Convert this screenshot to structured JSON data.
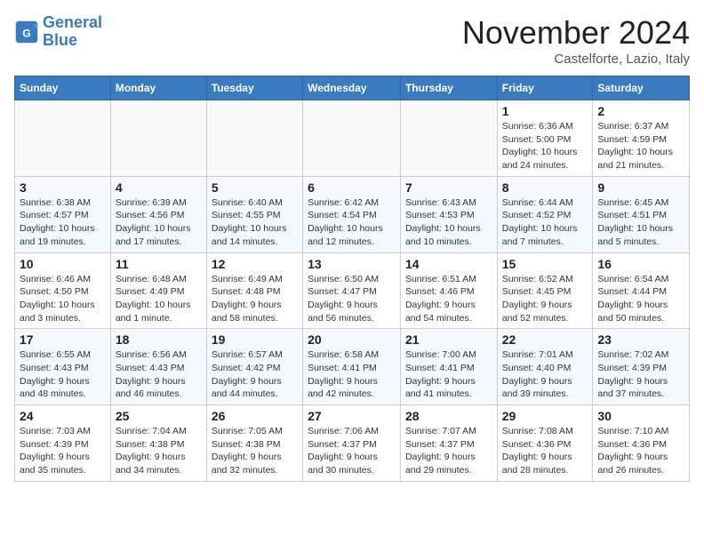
{
  "header": {
    "logo_line1": "General",
    "logo_line2": "Blue",
    "month": "November 2024",
    "location": "Castelforte, Lazio, Italy"
  },
  "weekdays": [
    "Sunday",
    "Monday",
    "Tuesday",
    "Wednesday",
    "Thursday",
    "Friday",
    "Saturday"
  ],
  "weeks": [
    [
      {
        "day": "",
        "info": ""
      },
      {
        "day": "",
        "info": ""
      },
      {
        "day": "",
        "info": ""
      },
      {
        "day": "",
        "info": ""
      },
      {
        "day": "",
        "info": ""
      },
      {
        "day": "1",
        "info": "Sunrise: 6:36 AM\nSunset: 5:00 PM\nDaylight: 10 hours and 24 minutes."
      },
      {
        "day": "2",
        "info": "Sunrise: 6:37 AM\nSunset: 4:59 PM\nDaylight: 10 hours and 21 minutes."
      }
    ],
    [
      {
        "day": "3",
        "info": "Sunrise: 6:38 AM\nSunset: 4:57 PM\nDaylight: 10 hours and 19 minutes."
      },
      {
        "day": "4",
        "info": "Sunrise: 6:39 AM\nSunset: 4:56 PM\nDaylight: 10 hours and 17 minutes."
      },
      {
        "day": "5",
        "info": "Sunrise: 6:40 AM\nSunset: 4:55 PM\nDaylight: 10 hours and 14 minutes."
      },
      {
        "day": "6",
        "info": "Sunrise: 6:42 AM\nSunset: 4:54 PM\nDaylight: 10 hours and 12 minutes."
      },
      {
        "day": "7",
        "info": "Sunrise: 6:43 AM\nSunset: 4:53 PM\nDaylight: 10 hours and 10 minutes."
      },
      {
        "day": "8",
        "info": "Sunrise: 6:44 AM\nSunset: 4:52 PM\nDaylight: 10 hours and 7 minutes."
      },
      {
        "day": "9",
        "info": "Sunrise: 6:45 AM\nSunset: 4:51 PM\nDaylight: 10 hours and 5 minutes."
      }
    ],
    [
      {
        "day": "10",
        "info": "Sunrise: 6:46 AM\nSunset: 4:50 PM\nDaylight: 10 hours and 3 minutes."
      },
      {
        "day": "11",
        "info": "Sunrise: 6:48 AM\nSunset: 4:49 PM\nDaylight: 10 hours and 1 minute."
      },
      {
        "day": "12",
        "info": "Sunrise: 6:49 AM\nSunset: 4:48 PM\nDaylight: 9 hours and 58 minutes."
      },
      {
        "day": "13",
        "info": "Sunrise: 6:50 AM\nSunset: 4:47 PM\nDaylight: 9 hours and 56 minutes."
      },
      {
        "day": "14",
        "info": "Sunrise: 6:51 AM\nSunset: 4:46 PM\nDaylight: 9 hours and 54 minutes."
      },
      {
        "day": "15",
        "info": "Sunrise: 6:52 AM\nSunset: 4:45 PM\nDaylight: 9 hours and 52 minutes."
      },
      {
        "day": "16",
        "info": "Sunrise: 6:54 AM\nSunset: 4:44 PM\nDaylight: 9 hours and 50 minutes."
      }
    ],
    [
      {
        "day": "17",
        "info": "Sunrise: 6:55 AM\nSunset: 4:43 PM\nDaylight: 9 hours and 48 minutes."
      },
      {
        "day": "18",
        "info": "Sunrise: 6:56 AM\nSunset: 4:43 PM\nDaylight: 9 hours and 46 minutes."
      },
      {
        "day": "19",
        "info": "Sunrise: 6:57 AM\nSunset: 4:42 PM\nDaylight: 9 hours and 44 minutes."
      },
      {
        "day": "20",
        "info": "Sunrise: 6:58 AM\nSunset: 4:41 PM\nDaylight: 9 hours and 42 minutes."
      },
      {
        "day": "21",
        "info": "Sunrise: 7:00 AM\nSunset: 4:41 PM\nDaylight: 9 hours and 41 minutes."
      },
      {
        "day": "22",
        "info": "Sunrise: 7:01 AM\nSunset: 4:40 PM\nDaylight: 9 hours and 39 minutes."
      },
      {
        "day": "23",
        "info": "Sunrise: 7:02 AM\nSunset: 4:39 PM\nDaylight: 9 hours and 37 minutes."
      }
    ],
    [
      {
        "day": "24",
        "info": "Sunrise: 7:03 AM\nSunset: 4:39 PM\nDaylight: 9 hours and 35 minutes."
      },
      {
        "day": "25",
        "info": "Sunrise: 7:04 AM\nSunset: 4:38 PM\nDaylight: 9 hours and 34 minutes."
      },
      {
        "day": "26",
        "info": "Sunrise: 7:05 AM\nSunset: 4:38 PM\nDaylight: 9 hours and 32 minutes."
      },
      {
        "day": "27",
        "info": "Sunrise: 7:06 AM\nSunset: 4:37 PM\nDaylight: 9 hours and 30 minutes."
      },
      {
        "day": "28",
        "info": "Sunrise: 7:07 AM\nSunset: 4:37 PM\nDaylight: 9 hours and 29 minutes."
      },
      {
        "day": "29",
        "info": "Sunrise: 7:08 AM\nSunset: 4:36 PM\nDaylight: 9 hours and 28 minutes."
      },
      {
        "day": "30",
        "info": "Sunrise: 7:10 AM\nSunset: 4:36 PM\nDaylight: 9 hours and 26 minutes."
      }
    ]
  ]
}
